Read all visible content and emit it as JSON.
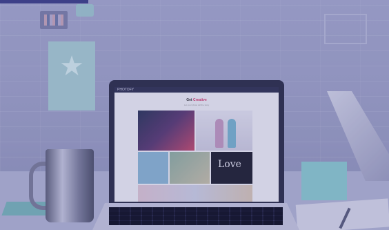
{
  "scene": {
    "description_colors": {
      "tint": "#4648a0",
      "accent_tab": "#3b3f86",
      "teal": "#8dcdd0"
    }
  },
  "laptop_screen": {
    "brand": "PHOTOFY",
    "heading_plain": "Get ",
    "heading_accent": "Creative",
    "subheading": "Let your photo tell the story",
    "love_text": "Love"
  },
  "icons": {
    "poster": "star-icon"
  }
}
